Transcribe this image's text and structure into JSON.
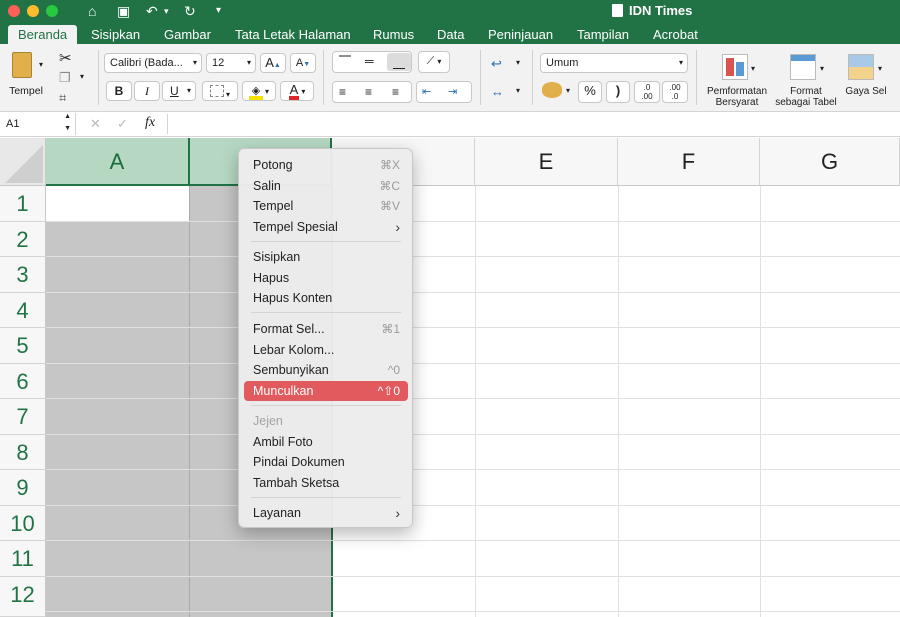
{
  "window": {
    "title": "IDN Times"
  },
  "tabs": [
    "Beranda",
    "Sisipkan",
    "Gambar",
    "Tata Letak Halaman",
    "Rumus",
    "Data",
    "Peninjauan",
    "Tampilan",
    "Acrobat"
  ],
  "ribbon": {
    "paste_label": "Tempel",
    "font_name": "Calibri (Bada...",
    "font_size": "12",
    "bold": "B",
    "italic": "I",
    "underline": "U",
    "grow_font": "A",
    "shrink_font": "A",
    "font_color": "A",
    "number_format": "Umum",
    "percent": "%",
    "comma": ")",
    "inc_dec": ".0\n.00",
    "dec_dec": ".00\n.0",
    "conditional_formatting": "Pemformatan Bersyarat",
    "format_as_table": "Format sebagai Tabel",
    "cell_styles": "Gaya Sel"
  },
  "formula_bar": {
    "name_box": "A1",
    "fx": "fx"
  },
  "columns": [
    "A",
    "",
    "",
    "",
    "E",
    "F",
    "G"
  ],
  "rows": [
    "1",
    "2",
    "3",
    "4",
    "5",
    "6",
    "7",
    "8",
    "9",
    "10",
    "11",
    "12"
  ],
  "context_menu": {
    "groups": [
      [
        {
          "label": "Potong",
          "shortcut": "⌘X"
        },
        {
          "label": "Salin",
          "shortcut": "⌘C"
        },
        {
          "label": "Tempel",
          "shortcut": "⌘V"
        },
        {
          "label": "Tempel Spesial",
          "shortcut": "›"
        }
      ],
      [
        {
          "label": "Sisipkan",
          "shortcut": ""
        },
        {
          "label": "Hapus",
          "shortcut": ""
        },
        {
          "label": "Hapus Konten",
          "shortcut": ""
        }
      ],
      [
        {
          "label": "Format Sel...",
          "shortcut": "⌘1"
        },
        {
          "label": "Lebar Kolom...",
          "shortcut": ""
        },
        {
          "label": "Sembunyikan",
          "shortcut": "^0"
        },
        {
          "label": "Munculkan",
          "shortcut": "^⇧0"
        }
      ],
      [
        {
          "label": "Jejen",
          "shortcut": ""
        },
        {
          "label": "Ambil Foto",
          "shortcut": ""
        },
        {
          "label": "Pindai Dokumen",
          "shortcut": ""
        },
        {
          "label": "Tambah Sketsa",
          "shortcut": ""
        }
      ],
      [
        {
          "label": "Layanan",
          "shortcut": "›"
        }
      ]
    ]
  },
  "colors": {
    "accent": "#217346",
    "highlight": "#e05a5e",
    "selection": "#c6c6c6"
  }
}
